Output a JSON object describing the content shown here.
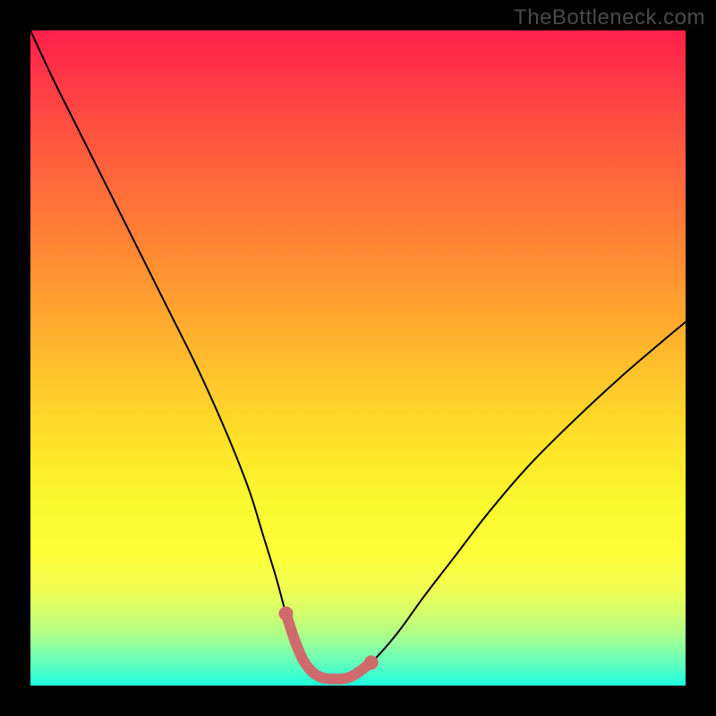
{
  "watermark": "TheBottleneck.com",
  "colors": {
    "frame": "#000000",
    "curve_stroke": "#000000",
    "valley_stroke": "#cf6b6d"
  },
  "chart_data": {
    "type": "line",
    "title": "",
    "xlabel": "",
    "ylabel": "",
    "xlim": [
      0,
      100
    ],
    "ylim": [
      0,
      100
    ],
    "series": [
      {
        "name": "bottleneck-curve",
        "x": [
          0,
          3.5,
          7,
          10,
          13,
          16,
          19,
          22,
          25,
          28,
          31,
          33.5,
          35.5,
          37.5,
          39,
          40.5,
          42,
          44,
          46.5,
          49,
          52,
          56,
          60,
          65,
          70,
          76,
          83,
          90,
          97,
          100
        ],
        "y": [
          100,
          92.5,
          85.5,
          79.5,
          73.5,
          67.5,
          61.5,
          55.5,
          49.5,
          43,
          36,
          29.5,
          23,
          16.5,
          11,
          6.5,
          3.3,
          1.4,
          1.0,
          1.4,
          3.5,
          8,
          13.5,
          20,
          26.5,
          33.5,
          40.5,
          47,
          53,
          55.5
        ]
      },
      {
        "name": "valley-highlight",
        "x": [
          39,
          40.5,
          42,
          44,
          46.5,
          49,
          52
        ],
        "y": [
          11,
          6.5,
          3.3,
          1.4,
          1.0,
          1.4,
          3.5
        ]
      }
    ]
  }
}
